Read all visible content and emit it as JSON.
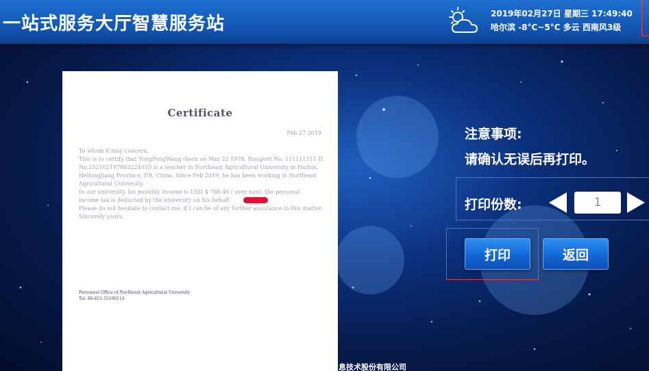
{
  "header": {
    "title": "一站式服务大厅智慧服务站",
    "datetime": "2019年02月27日 星期三 17:49:40",
    "weather": "哈尔滨 -8°C~5°C 多云 西南风3级",
    "weather_icon": "partly-cloudy-icon"
  },
  "document": {
    "title": "Certificate",
    "date": "Feb 27 2019",
    "lines": [
      "To whom it may concern,",
      "This is to certify that YongFengWang (born on Mar 22 1978, Passport No. 111111111 ID",
      "No.23210219780322401l) is a teacher in Northeast Agricultural University in Harbin,",
      "Heilongjiang Province, P.R. China. Since Feb 2019, he has been working in Northeast",
      "Agricultural University.",
      "In our university, his monthly income is USD $ 788.46 ( over              nan); the personal",
      "income tax is deducted by the university on his behalf.",
      "Please do not hesitate to contact me, if I can be of any further assistance in this matter.",
      "Sincerely yours,"
    ],
    "footer_org": "Personnel Office of Northeast Agricultural University",
    "footer_tel": "Tel: 86-451-55190114"
  },
  "notice": {
    "title": "注意事项:",
    "text": "请确认无误后再打印。"
  },
  "copies": {
    "label": "打印份数:",
    "value": "1"
  },
  "actions": {
    "print": "打印",
    "back": "返回"
  },
  "footer": {
    "text": "息技术股份有限公司"
  },
  "colors": {
    "accent": "#1467d6",
    "highlight": "#e0404a"
  }
}
